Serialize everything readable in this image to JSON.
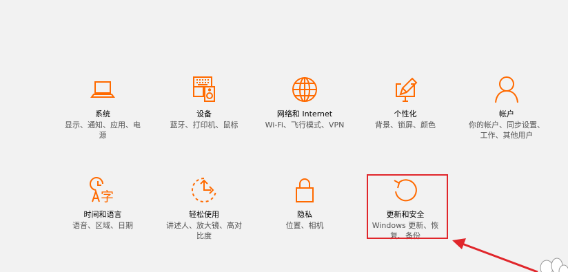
{
  "accent_color": "#ff6a00",
  "annotation_color": "#e0262b",
  "categories": [
    {
      "title": "系统",
      "desc": "显示、通知、应用、电源",
      "icon": "laptop-icon"
    },
    {
      "title": "设备",
      "desc": "蓝牙、打印机、鼠标",
      "icon": "keyboard-speaker-icon"
    },
    {
      "title": "网络和 Internet",
      "desc": "Wi-Fi、飞行模式、VPN",
      "icon": "globe-icon"
    },
    {
      "title": "个性化",
      "desc": "背景、锁屏、颜色",
      "icon": "paint-icon"
    },
    {
      "title": "帐户",
      "desc": "你的帐户、同步设置、工作、其他用户",
      "icon": "person-icon"
    },
    {
      "title": "时间和语言",
      "desc": "语音、区域、日期",
      "icon": "time-language-icon"
    },
    {
      "title": "轻松使用",
      "desc": "讲述人、放大镜、高对比度",
      "icon": "ease-of-access-icon"
    },
    {
      "title": "隐私",
      "desc": "位置、相机",
      "icon": "lock-icon"
    },
    {
      "title": "更新和安全",
      "desc": "Windows 更新、恢复、备份",
      "icon": "update-icon"
    }
  ]
}
